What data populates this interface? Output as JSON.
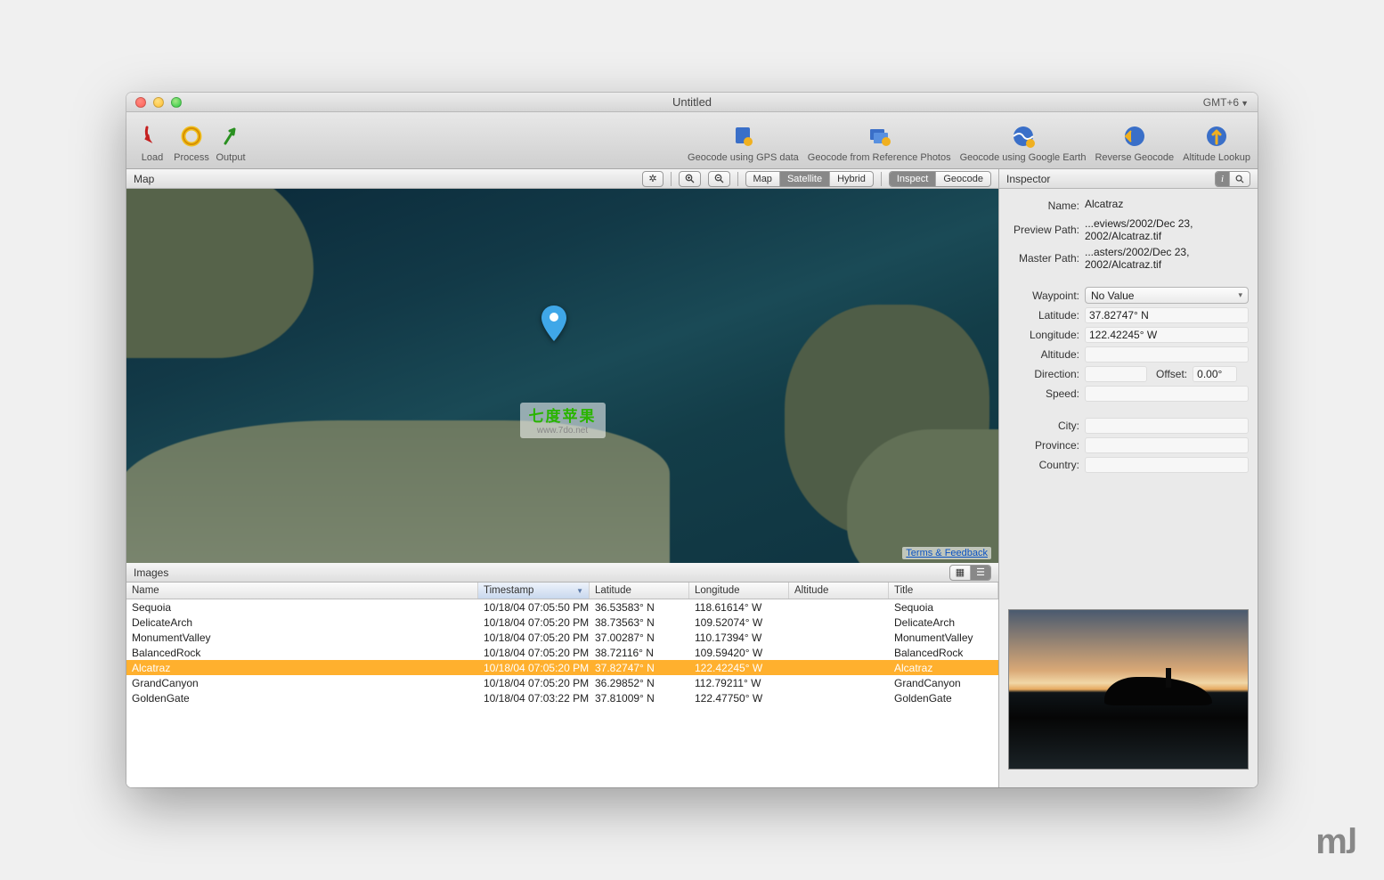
{
  "title": "Untitled",
  "timezone": "GMT+6",
  "toolbar": {
    "left": [
      {
        "id": "load",
        "label": "Load"
      },
      {
        "id": "process",
        "label": "Process"
      },
      {
        "id": "output",
        "label": "Output"
      }
    ],
    "right": [
      {
        "id": "geocode-gps",
        "label": "Geocode using GPS data"
      },
      {
        "id": "geocode-ref",
        "label": "Geocode from Reference Photos"
      },
      {
        "id": "geocode-gearth",
        "label": "Geocode using Google Earth"
      },
      {
        "id": "reverse-geo",
        "label": "Reverse Geocode"
      },
      {
        "id": "altitude",
        "label": "Altitude Lookup"
      }
    ]
  },
  "map": {
    "heading": "Map",
    "types": [
      "Map",
      "Satellite",
      "Hybrid"
    ],
    "active_type": "Satellite",
    "actions": [
      "Inspect",
      "Geocode"
    ],
    "active_action": "Inspect",
    "terms_link": "Terms & Feedback",
    "watermark_cn": "七度苹果",
    "watermark_url": "www.7do.net"
  },
  "images": {
    "heading": "Images",
    "columns": [
      "Name",
      "Timestamp",
      "Latitude",
      "Longitude",
      "Altitude",
      "Title"
    ],
    "sort_col": "Timestamp",
    "rows": [
      {
        "name": "Sequoia",
        "timestamp": "10/18/04 07:05:50 PM",
        "lat": "36.53583° N",
        "lon": "118.61614° W",
        "alt": "",
        "title": "Sequoia"
      },
      {
        "name": "DelicateArch",
        "timestamp": "10/18/04 07:05:20 PM",
        "lat": "38.73563° N",
        "lon": "109.52074° W",
        "alt": "",
        "title": "DelicateArch"
      },
      {
        "name": "MonumentValley",
        "timestamp": "10/18/04 07:05:20 PM",
        "lat": "37.00287° N",
        "lon": "110.17394° W",
        "alt": "",
        "title": "MonumentValley"
      },
      {
        "name": "BalancedRock",
        "timestamp": "10/18/04 07:05:20 PM",
        "lat": "38.72116° N",
        "lon": "109.59420° W",
        "alt": "",
        "title": "BalancedRock"
      },
      {
        "name": "Alcatraz",
        "timestamp": "10/18/04 07:05:20 PM",
        "lat": "37.82747° N",
        "lon": "122.42245° W",
        "alt": "",
        "title": "Alcatraz",
        "selected": true
      },
      {
        "name": "GrandCanyon",
        "timestamp": "10/18/04 07:05:20 PM",
        "lat": "36.29852° N",
        "lon": "112.79211° W",
        "alt": "",
        "title": "GrandCanyon"
      },
      {
        "name": "GoldenGate",
        "timestamp": "10/18/04 07:03:22 PM",
        "lat": "37.81009° N",
        "lon": "122.47750° W",
        "alt": "",
        "title": "GoldenGate"
      }
    ]
  },
  "inspector": {
    "heading": "Inspector",
    "name_label": "Name:",
    "name": "Alcatraz",
    "preview_label": "Preview Path:",
    "preview": "...eviews/2002/Dec 23, 2002/Alcatraz.tif",
    "master_label": "Master Path:",
    "master": "...asters/2002/Dec 23, 2002/Alcatraz.tif",
    "waypoint_label": "Waypoint:",
    "waypoint": "No Value",
    "lat_label": "Latitude:",
    "lat": "37.82747° N",
    "lon_label": "Longitude:",
    "lon": "122.42245° W",
    "alt_label": "Altitude:",
    "alt": "",
    "dir_label": "Direction:",
    "dir": "",
    "offset_label": "Offset:",
    "offset": "0.00°",
    "speed_label": "Speed:",
    "speed": "",
    "city_label": "City:",
    "city": "",
    "province_label": "Province:",
    "province": "",
    "country_label": "Country:",
    "country": ""
  }
}
